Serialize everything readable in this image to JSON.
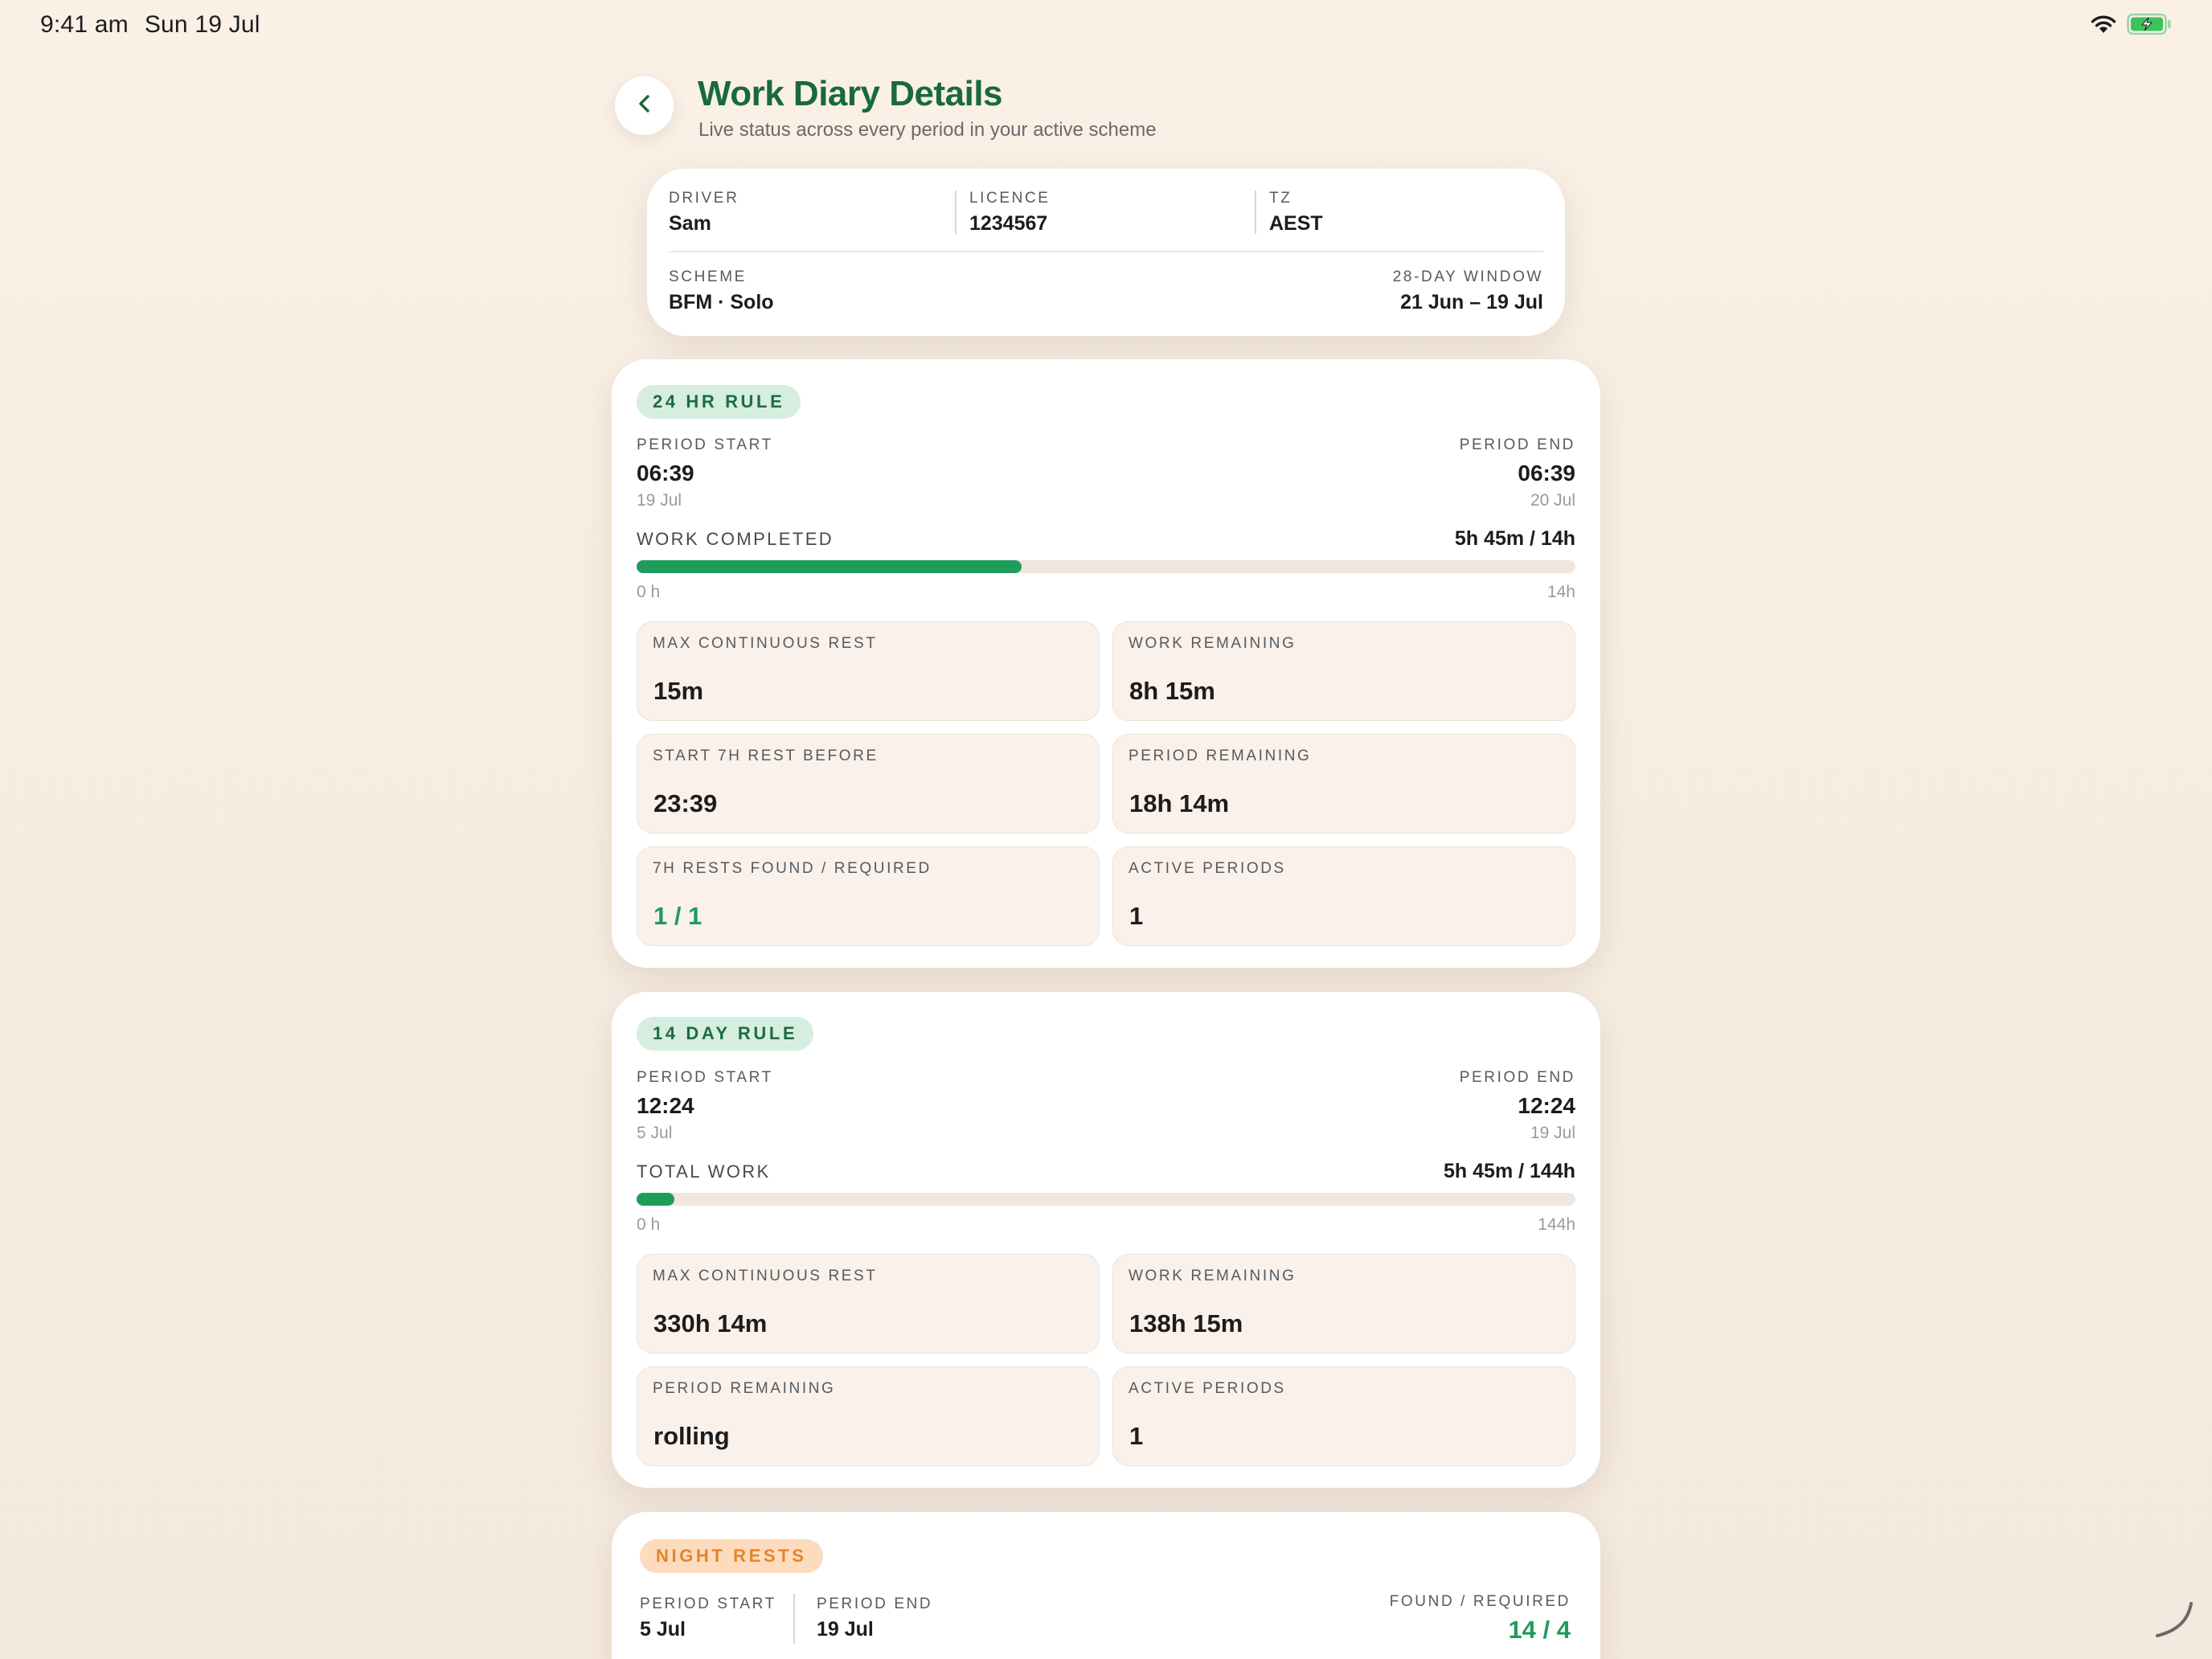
{
  "status_bar": {
    "time": "9:41 am",
    "date": "Sun 19 Jul"
  },
  "header": {
    "title": "Work Diary Details",
    "subtitle": "Live status across every period in your active scheme"
  },
  "driver_info": {
    "driver_label": "DRIVER",
    "driver_value": "Sam",
    "licence_label": "LICENCE",
    "licence_value": "1234567",
    "tz_label": "TZ",
    "tz_value": "AEST",
    "scheme_label": "SCHEME",
    "scheme_value": "BFM · Solo",
    "window_label": "28-DAY WINDOW",
    "window_value": "21 Jun – 19 Jul"
  },
  "rule_24hr": {
    "badge": "24 HR RULE",
    "period_start_label": "PERIOD START",
    "period_start_time": "06:39",
    "period_start_date": "19 Jul",
    "period_end_label": "PERIOD END",
    "period_end_time": "06:39",
    "period_end_date": "20 Jul",
    "progress_label": "WORK COMPLETED",
    "progress_value": "5h 45m / 14h",
    "progress_fraction": 0.41,
    "progress_min": "0 h",
    "progress_max": "14h",
    "tiles": [
      {
        "label": "MAX CONTINUOUS REST",
        "value": "15m"
      },
      {
        "label": "WORK REMAINING",
        "value": "8h 15m"
      },
      {
        "label": "START 7H REST BEFORE",
        "value": "23:39"
      },
      {
        "label": "PERIOD REMAINING",
        "value": "18h 14m"
      },
      {
        "label": "7H RESTS FOUND / REQUIRED",
        "value": "1 / 1"
      },
      {
        "label": "ACTIVE PERIODS",
        "value": "1"
      }
    ]
  },
  "rule_14day": {
    "badge": "14 DAY RULE",
    "period_start_label": "PERIOD START",
    "period_start_time": "12:24",
    "period_start_date": "5 Jul",
    "period_end_label": "PERIOD END",
    "period_end_time": "12:24",
    "period_end_date": "19 Jul",
    "progress_label": "TOTAL WORK",
    "progress_value": "5h 45m / 144h",
    "progress_fraction": 0.04,
    "progress_min": "0 h",
    "progress_max": "144h",
    "tiles": [
      {
        "label": "MAX CONTINUOUS REST",
        "value": "330h 14m"
      },
      {
        "label": "WORK REMAINING",
        "value": "138h 15m"
      },
      {
        "label": "PERIOD REMAINING",
        "value": "rolling"
      },
      {
        "label": "ACTIVE PERIODS",
        "value": "1"
      }
    ]
  },
  "night_rests": {
    "badge": "NIGHT RESTS",
    "period_start_label": "PERIOD START",
    "period_start_value": "5 Jul",
    "period_end_label": "PERIOD END",
    "period_end_value": "19 Jul",
    "found_label": "FOUND / REQUIRED",
    "found_value": "14 / 4"
  },
  "colors": {
    "accent_green": "#186a3b",
    "progress_green": "#1e9c5c",
    "night_orange": "#e2852f"
  }
}
